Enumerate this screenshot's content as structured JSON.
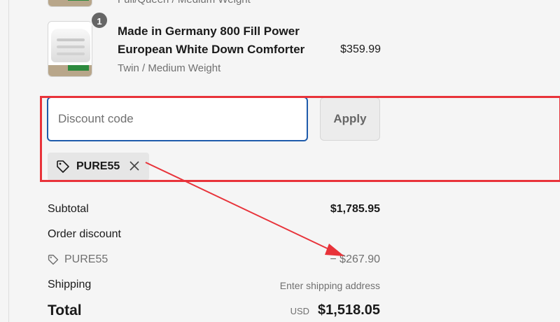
{
  "items": [
    {
      "variant": "Full/Queen / Medium Weight"
    },
    {
      "quantity": "1",
      "title": "Made in Germany 800 Fill Power European White Down Comforter",
      "variant": "Twin / Medium Weight",
      "price": "$359.99"
    }
  ],
  "discount": {
    "placeholder": "Discount code",
    "apply_label": "Apply",
    "applied_code": "PURE55"
  },
  "summary": {
    "subtotal_label": "Subtotal",
    "subtotal_value": "$1,785.95",
    "order_discount_label": "Order discount",
    "discount_code": "PURE55",
    "discount_value": "− $267.90",
    "shipping_label": "Shipping",
    "shipping_value": "Enter shipping address",
    "total_label": "Total",
    "currency": "USD",
    "total_value": "$1,518.05"
  },
  "annotation": {
    "highlight_color": "#e8333a",
    "arrow_color": "#e8333a"
  },
  "colors": {
    "input_focus_border": "#1e5bab",
    "background": "#f5f5f5"
  }
}
